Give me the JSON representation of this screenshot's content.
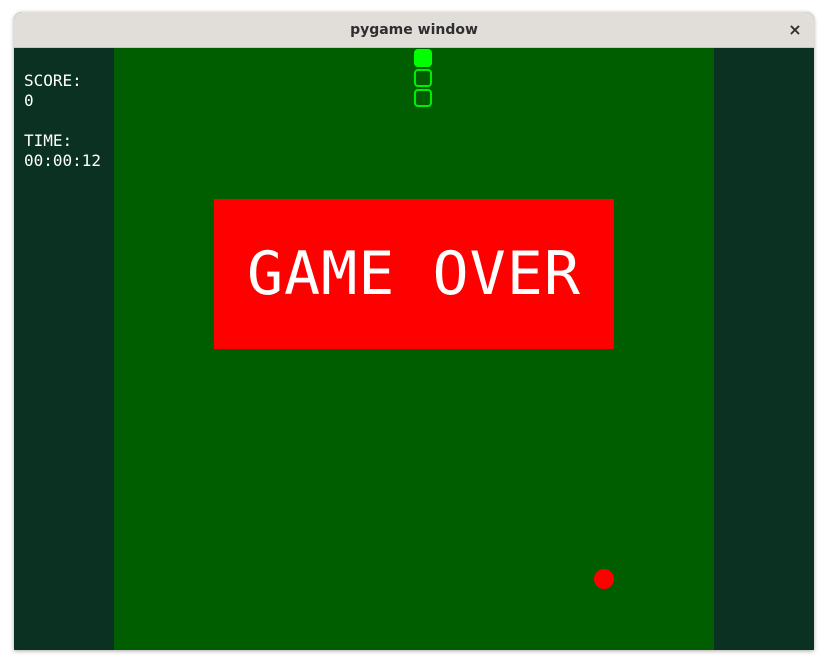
{
  "window": {
    "title": "pygame window",
    "close_label": "×"
  },
  "hud": {
    "score_label": "SCORE:",
    "score_value": "0",
    "time_label": "TIME:",
    "time_value": "00:00:12"
  },
  "game": {
    "overlay_text": "GAME OVER",
    "snake_segments": 3,
    "colors": {
      "background": "#0a3122",
      "field": "#005e00",
      "snake": "#00ff00",
      "food": "#ff0000",
      "overlay": "#ff0000",
      "text": "#ffffff"
    }
  }
}
